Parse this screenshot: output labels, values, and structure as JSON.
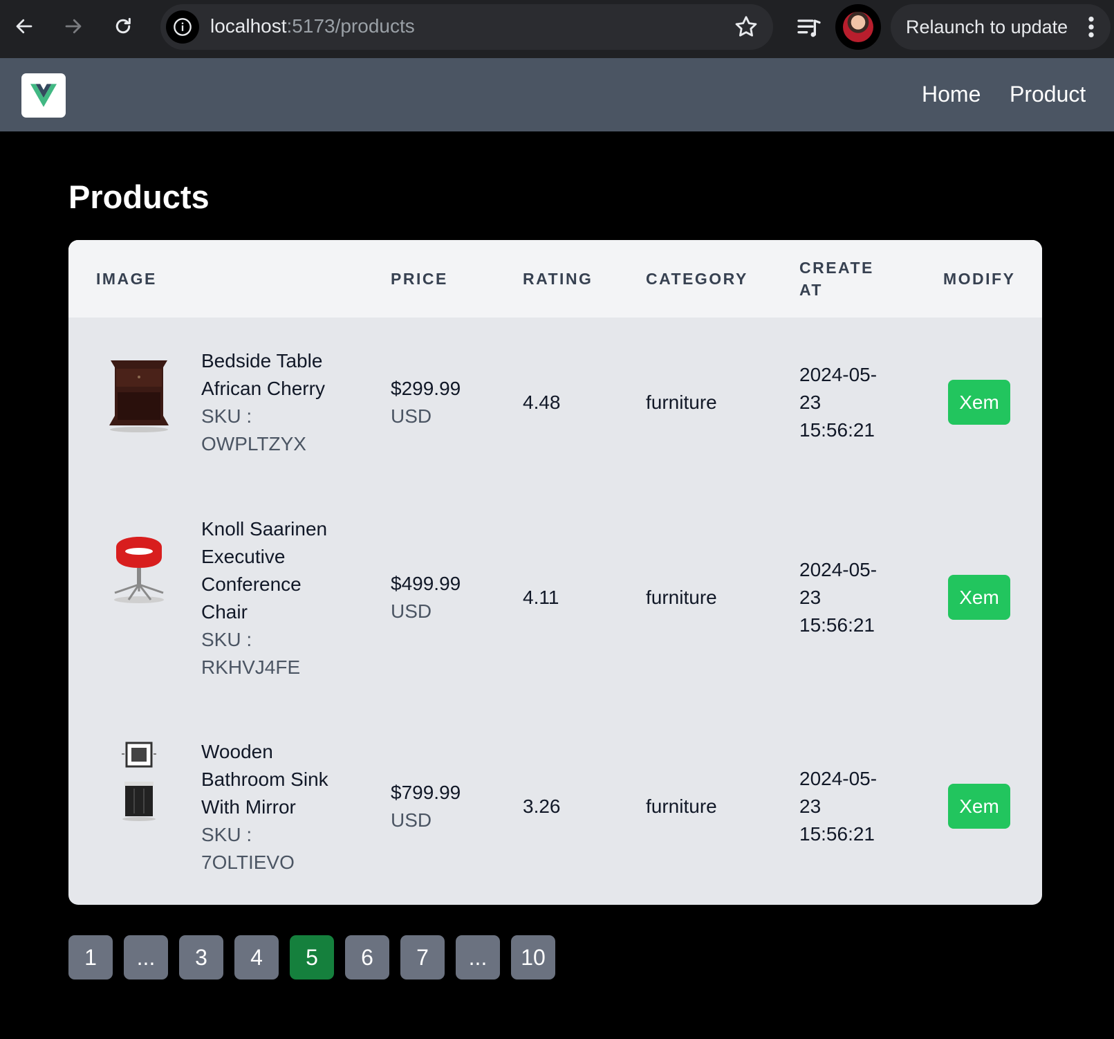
{
  "browser": {
    "url_host": "localhost",
    "url_path": ":5173/products",
    "relaunch_label": "Relaunch to update"
  },
  "header": {
    "logo_icon": "vue-logo-icon",
    "nav": [
      "Home",
      "Product"
    ]
  },
  "page": {
    "title": "Products"
  },
  "table": {
    "columns": {
      "image": "IMAGE",
      "price": "PRICE",
      "rating": "RATING",
      "category": "CATEGORY",
      "create_at_line1": "CREATE",
      "create_at_line2": "AT",
      "modify": "MODIFY"
    },
    "rows": [
      {
        "name_lines": [
          "Bedside Table",
          "African Cherry"
        ],
        "sku_label": "SKU :",
        "sku": "OWPLTZYX",
        "price": "$299.99",
        "currency": "USD",
        "rating": "4.48",
        "category": "furniture",
        "date_lines": [
          "2024-05-",
          "23",
          "15:56:21"
        ],
        "action": "Xem"
      },
      {
        "name_lines": [
          "Knoll Saarinen",
          "Executive",
          "Conference",
          "Chair"
        ],
        "sku_label": "SKU :",
        "sku": "RKHVJ4FE",
        "price": "$499.99",
        "currency": "USD",
        "rating": "4.11",
        "category": "furniture",
        "date_lines": [
          "2024-05-",
          "23",
          "15:56:21"
        ],
        "action": "Xem"
      },
      {
        "name_lines": [
          "Wooden",
          "Bathroom Sink",
          "With Mirror"
        ],
        "sku_label": "SKU :",
        "sku": "7OLTIEVO",
        "price": "$799.99",
        "currency": "USD",
        "rating": "3.26",
        "category": "furniture",
        "date_lines": [
          "2024-05-",
          "23",
          "15:56:21"
        ],
        "action": "Xem"
      }
    ]
  },
  "pagination": {
    "pages": [
      "1",
      "...",
      "3",
      "4",
      "5",
      "6",
      "7",
      "...",
      "10"
    ],
    "active": "5"
  },
  "colors": {
    "header_bg": "#4b5563",
    "action_green": "#22c55e",
    "active_page": "#15803d",
    "page_button": "#6b7280"
  }
}
